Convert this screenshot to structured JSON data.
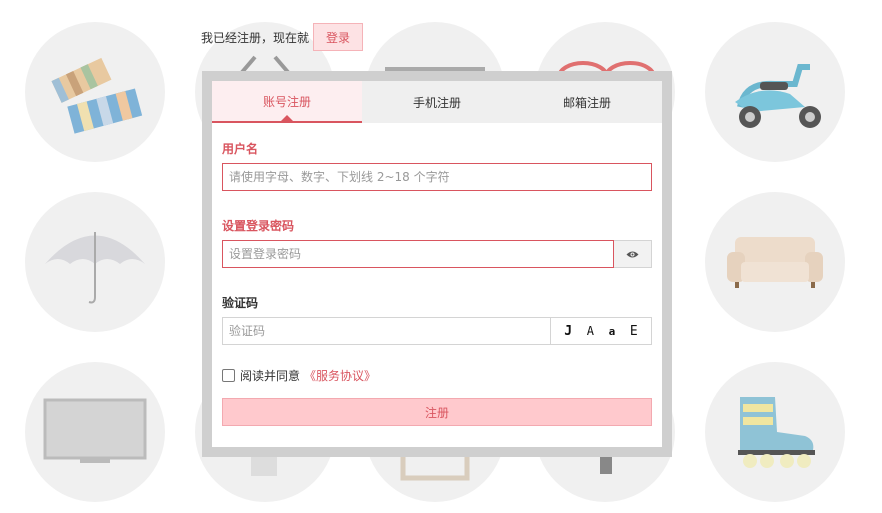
{
  "top": {
    "text": "我已经注册，现在就",
    "login_label": "登录"
  },
  "tabs": [
    {
      "label": "账号注册",
      "active": true
    },
    {
      "label": "手机注册",
      "active": false
    },
    {
      "label": "邮箱注册",
      "active": false
    }
  ],
  "form": {
    "username": {
      "label": "用户名",
      "placeholder": "请使用字母、数字、下划线 2~18 个字符",
      "value": ""
    },
    "password": {
      "label": "设置登录密码",
      "placeholder": "设置登录密码",
      "value": ""
    },
    "captcha": {
      "label": "验证码",
      "placeholder": "验证码",
      "value": "",
      "chars": [
        "J",
        "A",
        "a",
        "E"
      ]
    },
    "agree": {
      "text": "阅读并同意",
      "link": "《服务协议》",
      "checked": false
    },
    "submit_label": "注册"
  },
  "colors": {
    "accent": "#d9555f",
    "accent_light": "#fdeef0",
    "button_bg": "#ffc9cd",
    "frame": "#cfcfcf"
  },
  "icons": {
    "password_toggle": "eye-icon"
  },
  "background_items": [
    "scarves-icon",
    "sunglasses-icon",
    "glasses-icon",
    "scooter-icon",
    "umbrella-icon",
    "sofa-icon",
    "tv-icon",
    "lamp-icon",
    "picture-frame-icon",
    "roller-skate-icon"
  ]
}
